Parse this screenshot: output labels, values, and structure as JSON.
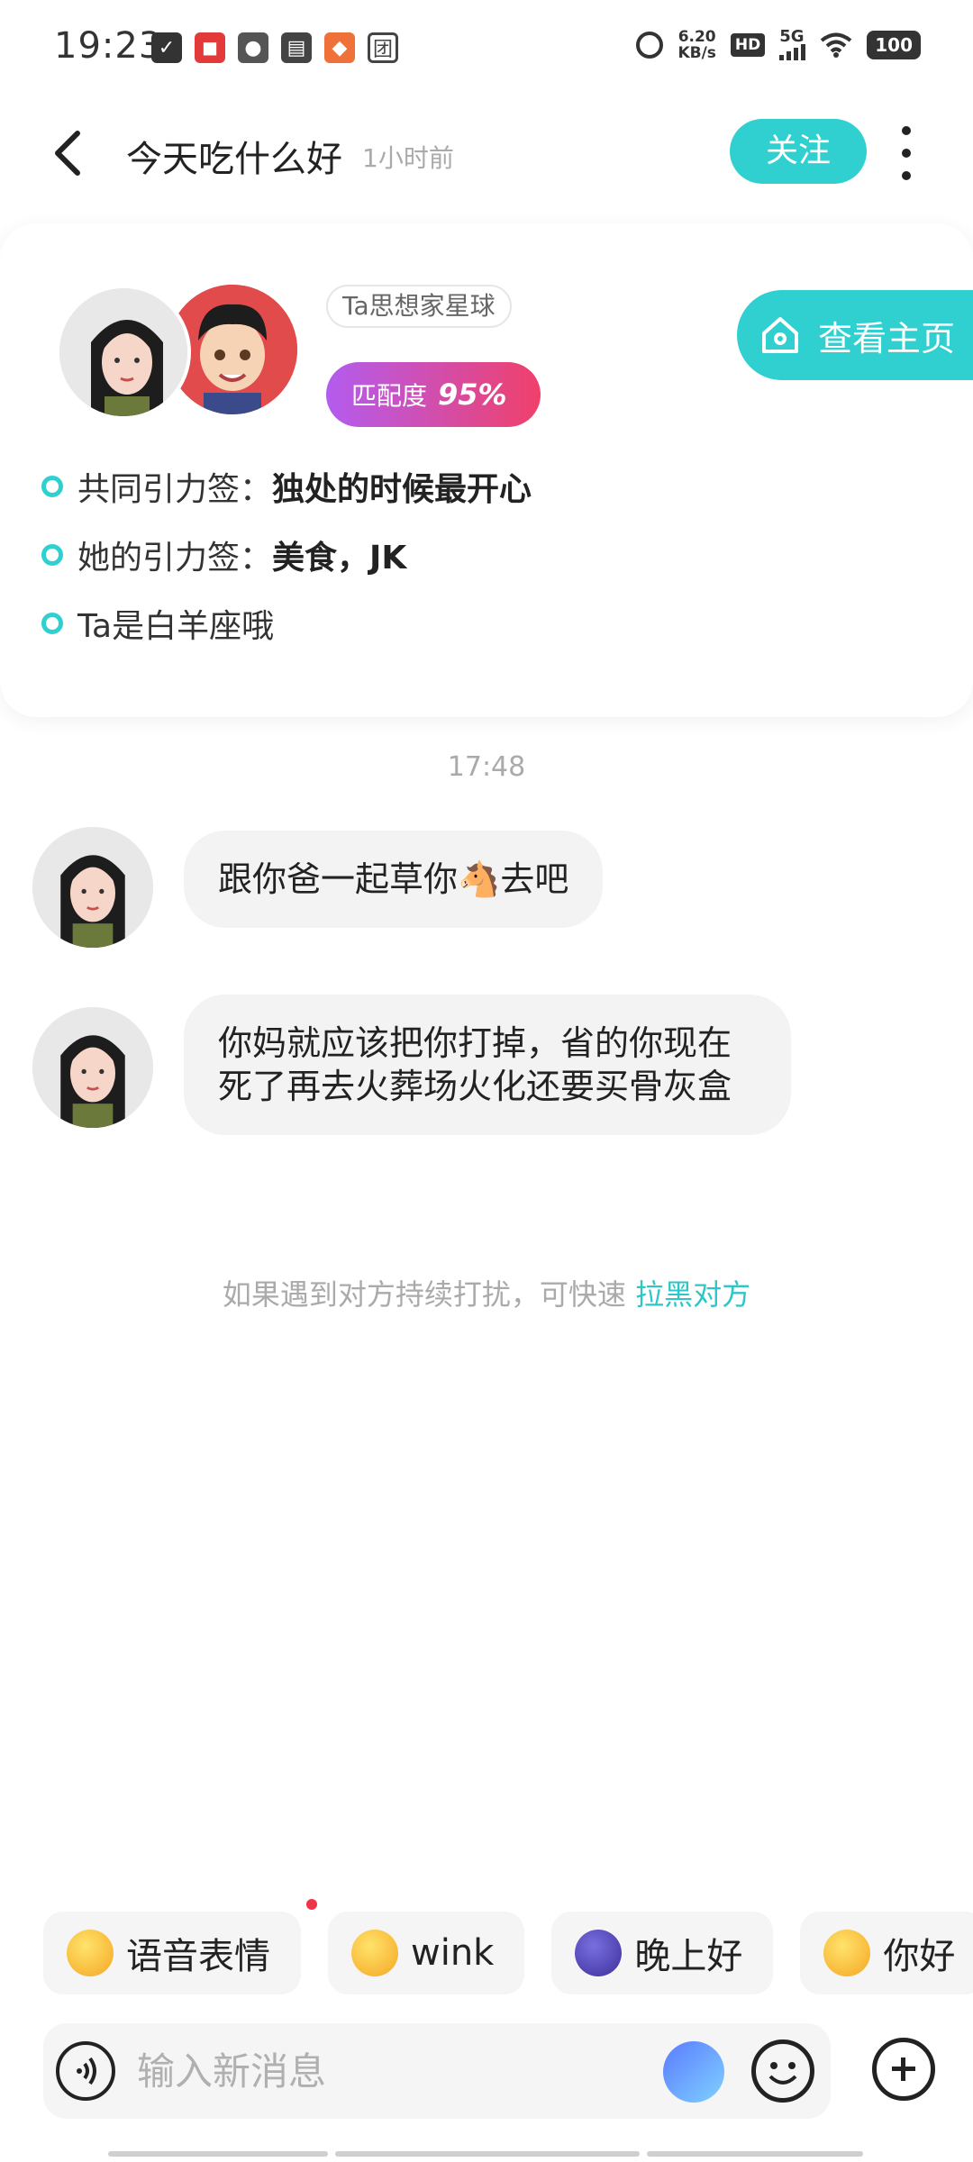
{
  "status_bar": {
    "time": "19:23",
    "net_speed_value": "6.20",
    "net_speed_unit": "KB/s",
    "hd_badge": "HD",
    "network_type": "5G",
    "battery": "100"
  },
  "header": {
    "title": "今天吃什么好",
    "time_ago": "1小时前",
    "follow_label": "关注"
  },
  "profile_card": {
    "planet_tag": "Ta思想家星球",
    "match_label": "匹配度",
    "match_value": "95%",
    "homepage_label": "查看主页",
    "tags": [
      {
        "label": "共同引力签：",
        "value": "独处的时候最开心"
      },
      {
        "label": "她的引力签：",
        "value": "美食，JK"
      },
      {
        "label": "Ta是白羊座哦",
        "value": ""
      }
    ]
  },
  "chat": {
    "timestamp": "17:48",
    "messages": [
      {
        "text": "跟你爸一起草你🐴去吧"
      },
      {
        "text": "你妈就应该把你打掉，省的你现在死了再去火葬场火化还要买骨灰盒"
      }
    ],
    "block_hint": "如果遇到对方持续打扰，可快速",
    "block_link": "拉黑对方"
  },
  "quick_replies": [
    {
      "label": "语音表情",
      "icon": "smile-emoji-icon"
    },
    {
      "label": "wink",
      "icon": "wink-emoji-icon"
    },
    {
      "label": "晚上好",
      "icon": "moon-emoji-icon"
    },
    {
      "label": "你好",
      "icon": "hello-emoji-icon"
    }
  ],
  "input": {
    "placeholder": "输入新消息"
  },
  "colors": {
    "accent": "#2fd0cf",
    "match_gradient_start": "#b35cf0",
    "match_gradient_end": "#f0406a"
  }
}
